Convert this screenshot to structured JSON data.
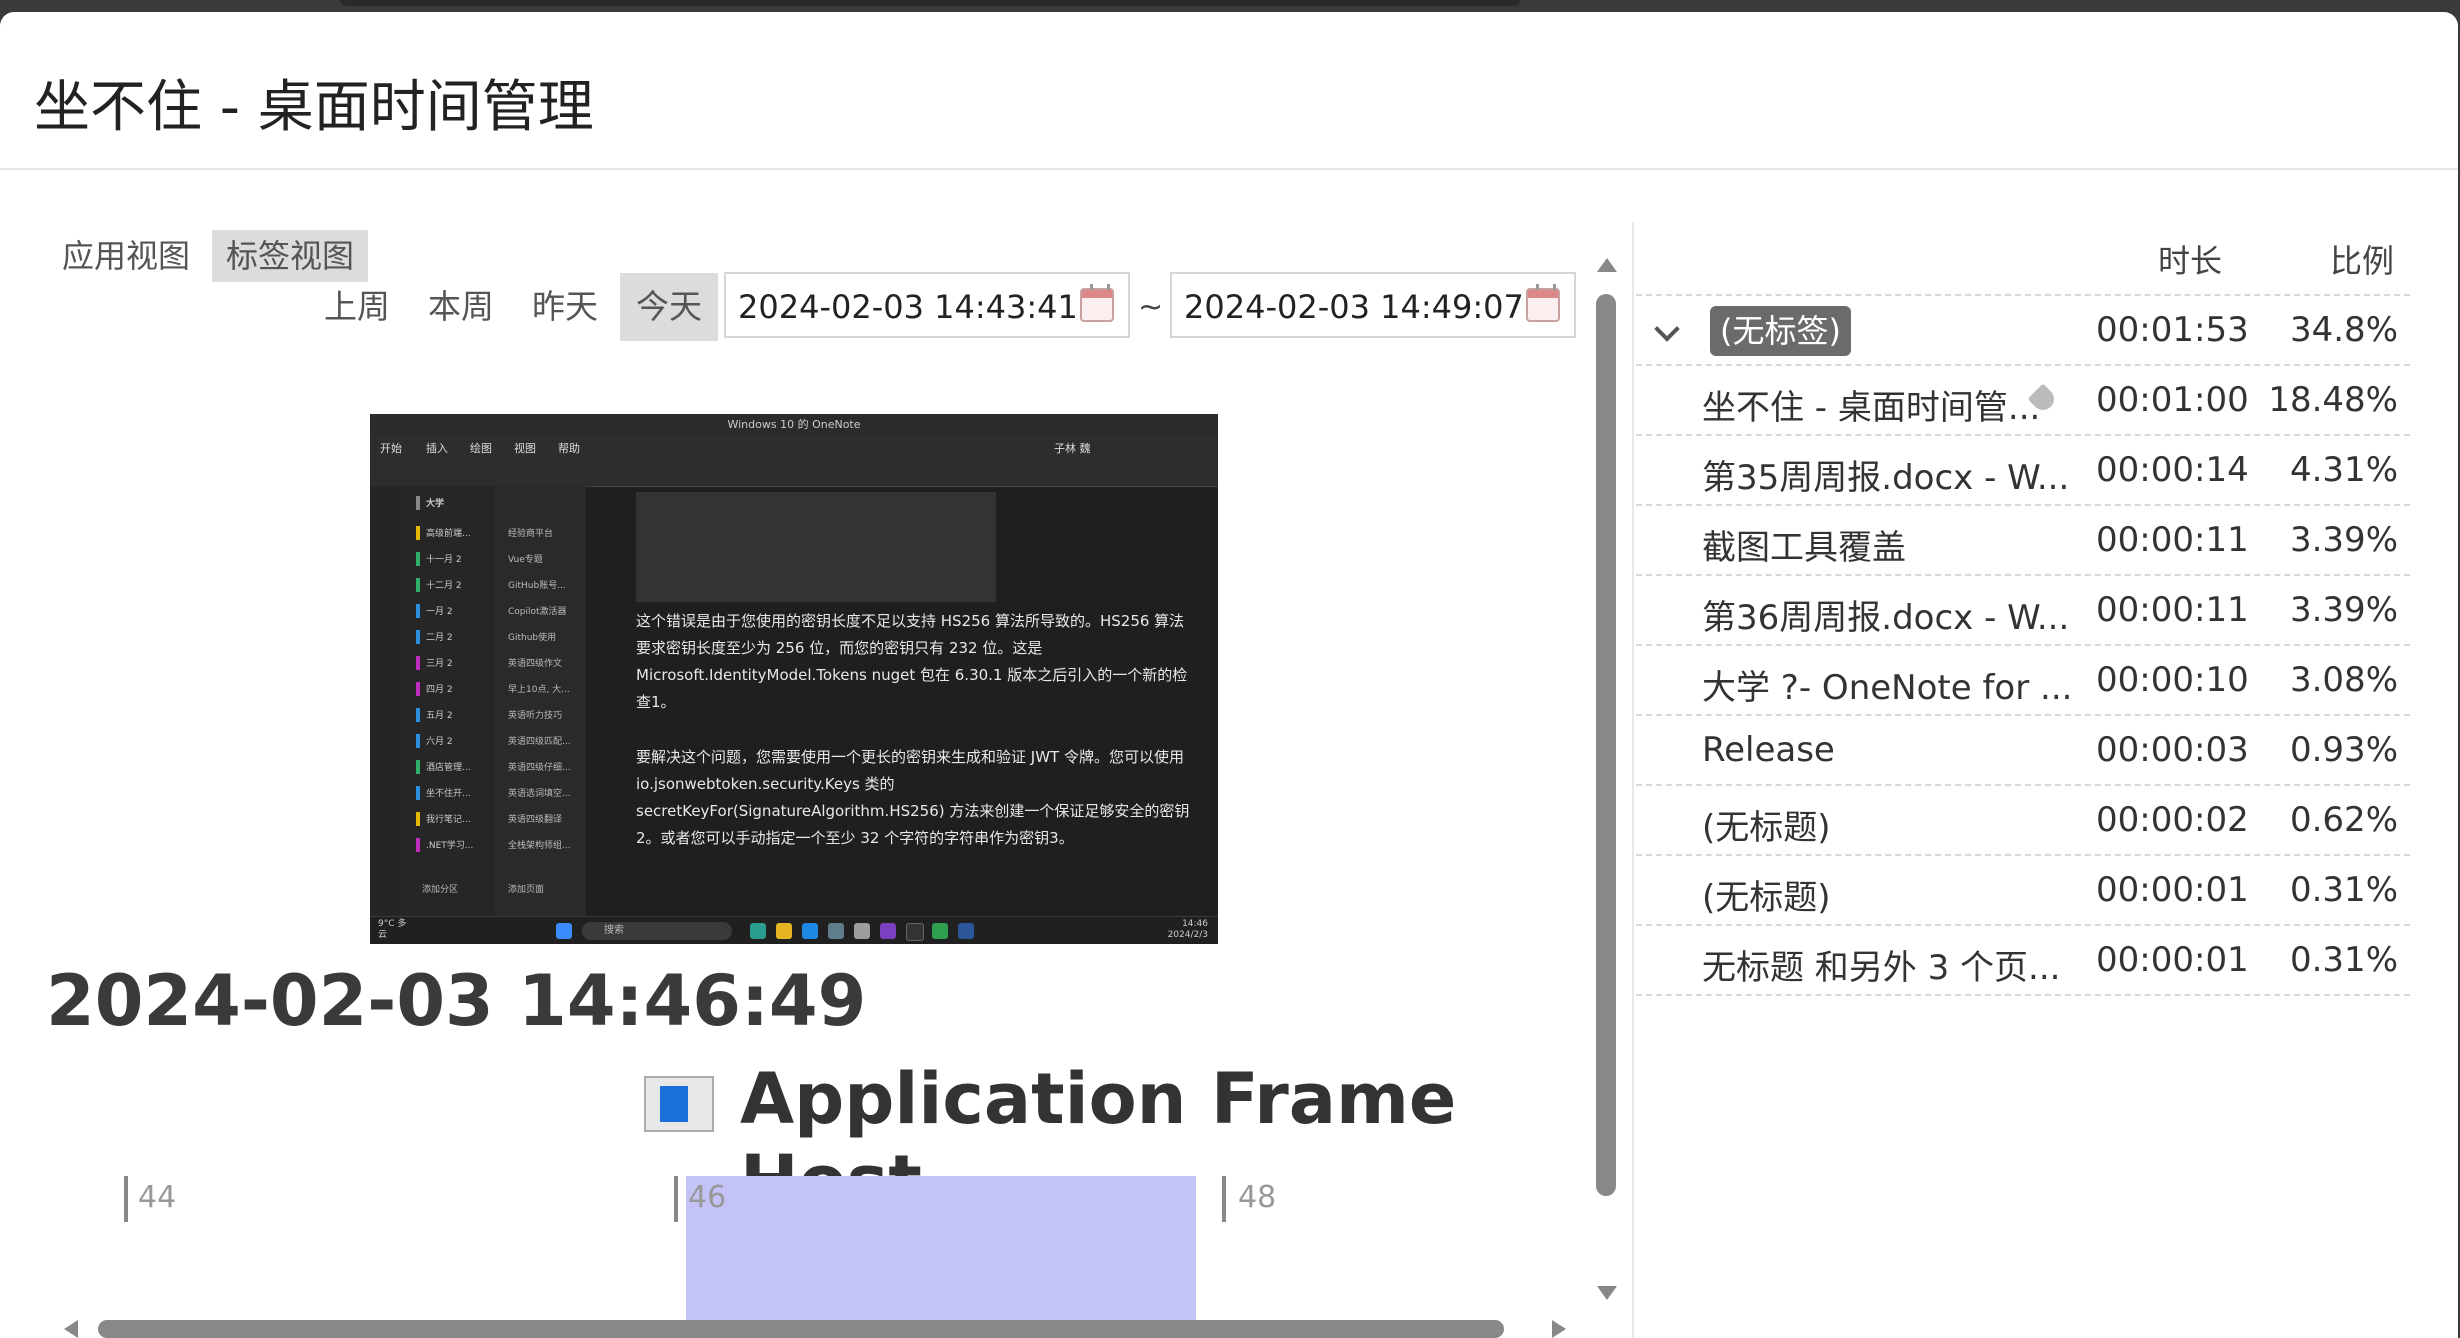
{
  "window": {
    "title": "坐不住 - 桌面时间管理"
  },
  "view_tabs": {
    "app": "应用视图",
    "tag": "标签视图"
  },
  "range": {
    "last_week": "上周",
    "this_week": "本周",
    "yesterday": "昨天",
    "today": "今天",
    "start": "2024-02-03 14:43:41",
    "end": "2024-02-03 14:49:07",
    "separator": "~"
  },
  "preview": {
    "window_title": "Windows 10 的 OneNote",
    "user": "子林 魏",
    "ribbon_tabs": [
      "开始",
      "插入",
      "绘图",
      "视图",
      "帮助"
    ],
    "notebook": "大学",
    "sections": [
      "高级前端...",
      "十一月 2",
      "十二月 2",
      "一月 2",
      "二月 2",
      "三月 2",
      "四月 2",
      "五月 2",
      "六月 2",
      "酒店管理...",
      "坐不住开...",
      "我行笔记...",
      ".NET学习..."
    ],
    "pages": [
      "经验商平台",
      "Vue专题",
      "GitHub账号...",
      "Copilot激活器",
      "Github使用",
      "英语四级作文",
      "早上10点, 大...",
      "英语听力技巧",
      "英语四级匹配...",
      "英语四级仔细...",
      "英语选词填空...",
      "英语四级翻译",
      "全栈架构师组..."
    ],
    "add_section": "添加分区",
    "add_page": "添加页面",
    "paragraph1": "这个错误是由于您使用的密钥长度不足以支持 HS256 算法所导致的。HS256 算法要求密钥长度至少为 256 位，而您的密钥只有 232 位。这是 Microsoft.IdentityModel.Tokens nuget 包在 6.30.1 版本之后引入的一个新的检查1。",
    "paragraph2": "要解决这个问题，您需要使用一个更长的密钥来生成和验证 JWT 令牌。您可以使用 io.jsonwebtoken.security.Keys 类的 secretKeyFor(SignatureAlgorithm.HS256) 方法来创建一个保证足够安全的密钥2。或者您可以手动指定一个至少 32 个字符的字符串作为密钥3。",
    "taskbar_weather": "9°C 多云",
    "taskbar_search": "搜索",
    "taskbar_time": "14:46",
    "taskbar_date": "2024/2/3"
  },
  "detail": {
    "timestamp": "2024-02-03 14:46:49",
    "app_icon": "application-window-icon",
    "app_name": "Application Frame Host"
  },
  "timeline": {
    "ticks": [
      "44",
      "46",
      "48"
    ],
    "highlight_color": "#c3c3f7"
  },
  "table": {
    "headers": {
      "duration": "时长",
      "ratio": "比例"
    },
    "group": {
      "label": "(无标签)",
      "duration": "00:01:53",
      "ratio": "34.8%"
    },
    "rows": [
      {
        "name": "坐不住 - 桌面时间管...",
        "duration": "00:01:00",
        "ratio": "18.48%"
      },
      {
        "name": "第35周周报.docx - W...",
        "duration": "00:00:14",
        "ratio": "4.31%"
      },
      {
        "name": "截图工具覆盖",
        "duration": "00:00:11",
        "ratio": "3.39%"
      },
      {
        "name": "第36周周报.docx - W...",
        "duration": "00:00:11",
        "ratio": "3.39%"
      },
      {
        "name": "大学 ?- OneNote for ...",
        "duration": "00:00:10",
        "ratio": "3.08%"
      },
      {
        "name": "Release",
        "duration": "00:00:03",
        "ratio": "0.93%"
      },
      {
        "name": "(无标题)",
        "duration": "00:00:02",
        "ratio": "0.62%"
      },
      {
        "name": "(无标题)",
        "duration": "00:00:01",
        "ratio": "0.31%"
      },
      {
        "name": "无标题 和另外 3 个页...",
        "duration": "00:00:01",
        "ratio": "0.31%"
      }
    ]
  }
}
